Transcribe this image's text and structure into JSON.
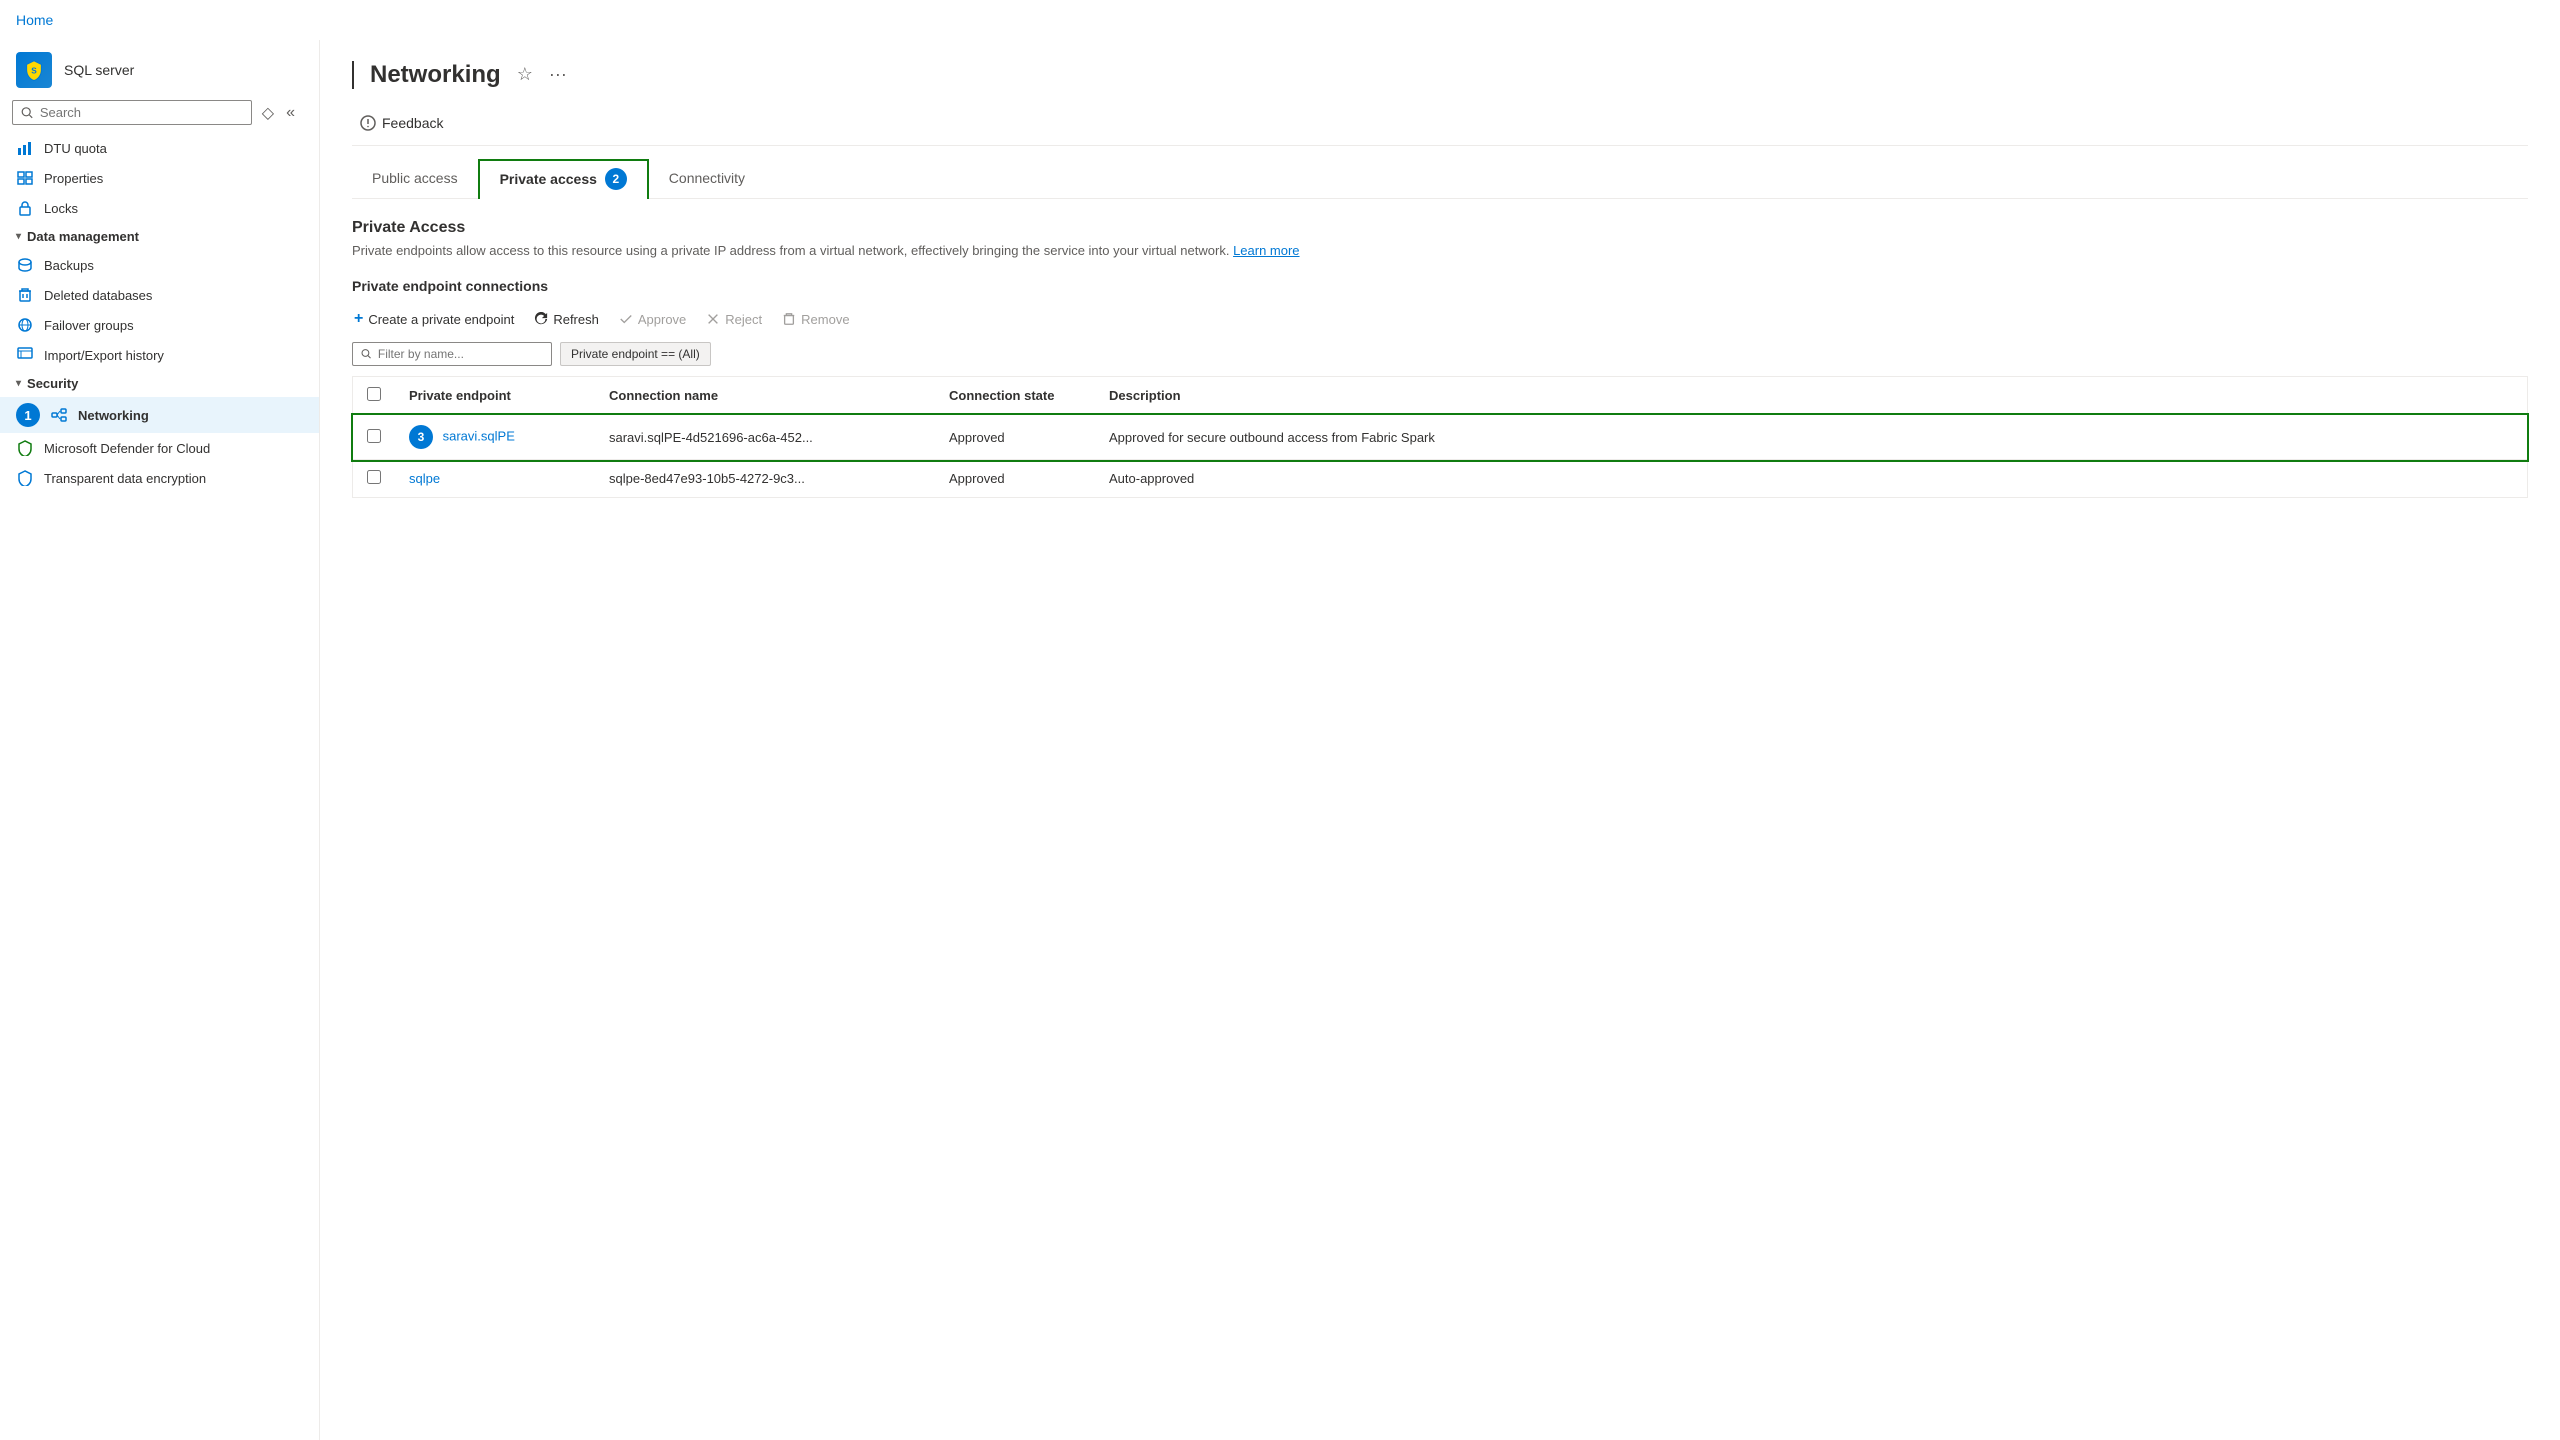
{
  "topbar": {
    "home_label": "Home"
  },
  "sidebar": {
    "resource_name": "SQL server",
    "search_placeholder": "Search",
    "items": [
      {
        "id": "dtu-quota",
        "label": "DTU quota",
        "icon": "chart"
      },
      {
        "id": "properties",
        "label": "Properties",
        "icon": "properties"
      },
      {
        "id": "locks",
        "label": "Locks",
        "icon": "lock"
      },
      {
        "id": "data-management",
        "label": "Data management",
        "type": "section",
        "expanded": true
      },
      {
        "id": "backups",
        "label": "Backups",
        "icon": "backup"
      },
      {
        "id": "deleted-databases",
        "label": "Deleted databases",
        "icon": "trash"
      },
      {
        "id": "failover-groups",
        "label": "Failover groups",
        "icon": "globe"
      },
      {
        "id": "import-export-history",
        "label": "Import/Export history",
        "icon": "import"
      },
      {
        "id": "security",
        "label": "Security",
        "type": "section",
        "expanded": true
      },
      {
        "id": "networking",
        "label": "Networking",
        "icon": "shield-network",
        "active": true,
        "badge": 1
      },
      {
        "id": "microsoft-defender",
        "label": "Microsoft Defender for Cloud",
        "icon": "defender"
      },
      {
        "id": "transparent-data",
        "label": "Transparent data encryption",
        "icon": "encryption"
      }
    ]
  },
  "page": {
    "title": "Networking",
    "resource_prefix": "|"
  },
  "feedback": {
    "label": "Feedback",
    "icon": "feedback"
  },
  "tabs": [
    {
      "id": "public-access",
      "label": "Public access",
      "active": false
    },
    {
      "id": "private-access",
      "label": "Private access",
      "active": true,
      "badge": "2"
    },
    {
      "id": "connectivity",
      "label": "Connectivity",
      "active": false
    }
  ],
  "private_access": {
    "section_title": "Private Access",
    "section_desc": "Private endpoints allow access to this resource using a private IP address from a virtual network, effectively bringing the service into your virtual network.",
    "learn_more": "Learn more",
    "connections_title": "Private endpoint connections",
    "actions": {
      "create": "Create a private endpoint",
      "refresh": "Refresh",
      "approve": "Approve",
      "reject": "Reject",
      "remove": "Remove"
    },
    "filter_placeholder": "Filter by name...",
    "filter_tag": "Private endpoint == (All)",
    "table": {
      "columns": [
        "Private endpoint",
        "Connection name",
        "Connection state",
        "Description"
      ],
      "rows": [
        {
          "id": 3,
          "endpoint": "saravi.sqlPE",
          "connection_name": "saravi.sqlPE-4d521696-ac6a-452...",
          "state": "Approved",
          "description": "Approved for secure outbound access from Fabric Spark",
          "highlighted": true
        },
        {
          "id": null,
          "endpoint": "sqlpe",
          "connection_name": "sqlpe-8ed47e93-10b5-4272-9c3...",
          "state": "Approved",
          "description": "Auto-approved",
          "highlighted": false
        }
      ]
    }
  }
}
